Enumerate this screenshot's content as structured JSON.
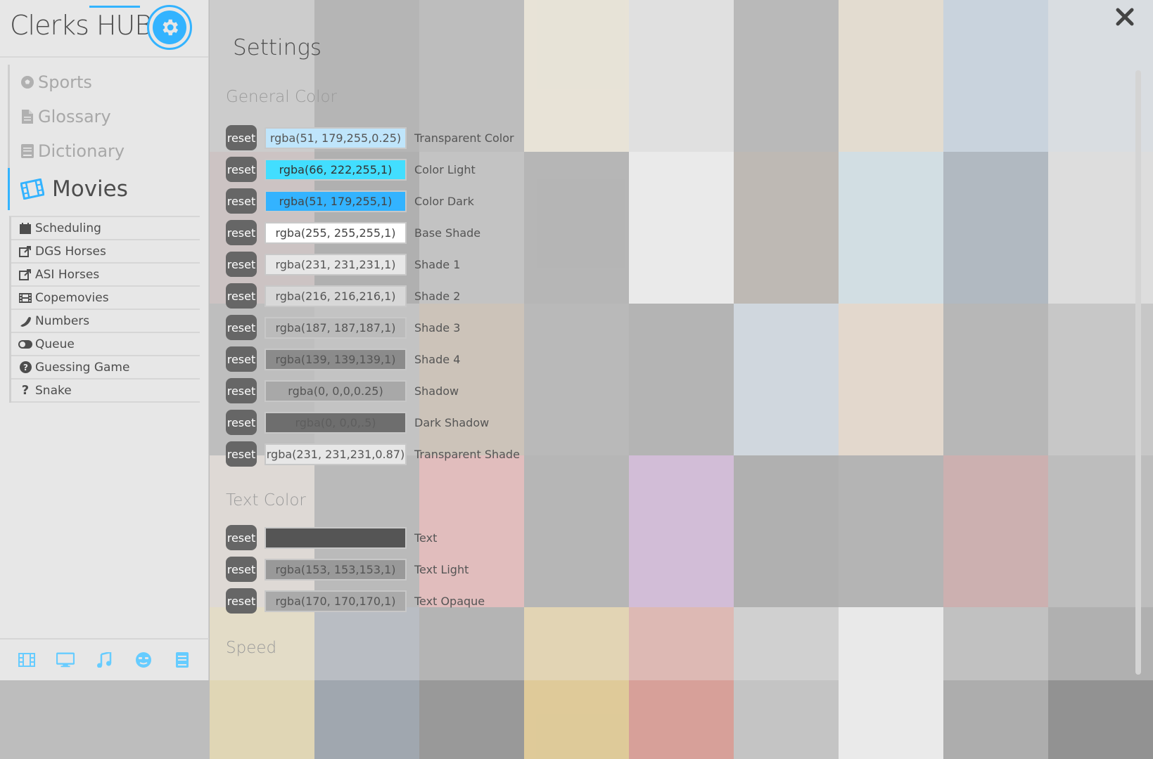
{
  "app": {
    "title": "Clerks HUB",
    "accent": "#33b3ff"
  },
  "main_nav": [
    {
      "label": "Sports",
      "icon": "soccer-ball-icon"
    },
    {
      "label": "Glossary",
      "icon": "document-icon"
    },
    {
      "label": "Dictionary",
      "icon": "book-icon"
    },
    {
      "label": "Movies",
      "icon": "film-icon",
      "active": true
    }
  ],
  "sub_nav": [
    {
      "label": "Scheduling",
      "icon": "calendar-icon"
    },
    {
      "label": "DGS Horses",
      "icon": "external-link-icon"
    },
    {
      "label": "ASI Horses",
      "icon": "external-link-icon"
    },
    {
      "label": "Copemovies",
      "icon": "film-strip-icon"
    },
    {
      "label": "Numbers",
      "icon": "phone-icon"
    },
    {
      "label": "Queue",
      "icon": "toggle-icon"
    },
    {
      "label": "Guessing Game",
      "icon": "question-circle-icon"
    },
    {
      "label": "Snake",
      "icon": "question-icon"
    }
  ],
  "bottom_bar": [
    "film-icon",
    "monitor-icon",
    "music-icon",
    "face-icon",
    "book-icon"
  ],
  "settings": {
    "title": "Settings",
    "reset_label": "reset",
    "general_title": "General Color",
    "general": [
      {
        "value": "rgba(51, 179,255,0.25)",
        "label": "Transparent Color",
        "bg": "#bfe5fb",
        "text": "#555"
      },
      {
        "value": "rgba(66, 222,255,1)",
        "label": "Color Light",
        "bg": "#42deff",
        "text": "#333"
      },
      {
        "value": "rgba(51, 179,255,1)",
        "label": "Color Dark",
        "bg": "#33b3ff",
        "text": "#444"
      },
      {
        "value": "rgba(255, 255,255,1)",
        "label": "Base Shade",
        "bg": "#ffffff",
        "text": "#444"
      },
      {
        "value": "rgba(231, 231,231,1)",
        "label": "Shade 1",
        "bg": "#e7e7e7",
        "text": "#555"
      },
      {
        "value": "rgba(216, 216,216,1)",
        "label": "Shade 2",
        "bg": "#d8d8d8",
        "text": "#555"
      },
      {
        "value": "rgba(187, 187,187,1)",
        "label": "Shade 3",
        "bg": "#bbbbbb",
        "text": "#555"
      },
      {
        "value": "rgba(139, 139,139,1)",
        "label": "Shade 4",
        "bg": "#8b8b8b",
        "text": "#555"
      },
      {
        "value": "rgba(0, 0,0,0.25)",
        "label": "Shadow",
        "bg": "#a8a8a8",
        "text": "#555"
      },
      {
        "value": "rgba(0, 0,0,.5)",
        "label": "Dark Shadow",
        "bg": "#6e6e6e",
        "text": "#5e5e5e"
      },
      {
        "value": "rgba(231, 231,231,0.87)",
        "label": "Transparent Shade",
        "bg": "#e7e7e7",
        "text": "#555"
      }
    ],
    "text_title": "Text Color",
    "text": [
      {
        "value": "",
        "label": "Text",
        "bg": "#555555",
        "text": "#555"
      },
      {
        "value": "rgba(153, 153,153,1)",
        "label": "Text Light",
        "bg": "#999999",
        "text": "#555"
      },
      {
        "value": "rgba(170, 170,170,1)",
        "label": "Text Opaque",
        "bg": "#aaaaaa",
        "text": "#555"
      }
    ],
    "speed_title": "Speed"
  },
  "poster_colors": [
    "#8d8d8d",
    "#3c3c3c",
    "#5a5a5a",
    "#e8d9b0",
    "#cfcfcf",
    "#4b4b4b",
    "#d8c29a",
    "#7fa2c6",
    "#b9c6d3",
    "#8a6a6a",
    "#2a2a2a",
    "#6b6b6b",
    "#3e3e3e",
    "#f0f0f0",
    "#5c4a3a",
    "#9ec7d8",
    "#2f4b66",
    "#c6c6c6",
    "#5c5c5c",
    "#6a6a6a",
    "#8b6b4b",
    "#4a4a4a",
    "#3a3a3a",
    "#9ab0c8",
    "#d7b48f",
    "#444444",
    "#7a7a7a",
    "#c8b8a8",
    "#4c4c4c",
    "#d35a5a",
    "#3f3f3f",
    "#a05ab0",
    "#2e2e2e",
    "#3a3a3a",
    "#8c2b2b",
    "#5a5a5a",
    "#d8c078",
    "#4a5a6a",
    "#3a3a3a",
    "#d4a63a",
    "#c44a3a",
    "#9a9a9a",
    "#eeeeee",
    "#666666",
    "#2a2a2a"
  ]
}
